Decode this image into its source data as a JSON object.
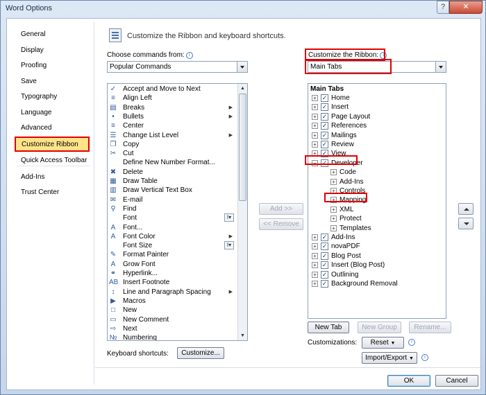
{
  "window": {
    "title": "Word Options",
    "help_glyph": "?",
    "close_glyph": "✕"
  },
  "nav": {
    "items": [
      {
        "label": "General"
      },
      {
        "label": "Display"
      },
      {
        "label": "Proofing"
      },
      {
        "label": "Save"
      },
      {
        "label": "Typography"
      },
      {
        "label": "Language"
      },
      {
        "label": "Advanced"
      },
      {
        "label": "Customize Ribbon"
      },
      {
        "label": "Quick Access Toolbar"
      },
      {
        "label": "Add-Ins"
      },
      {
        "label": "Trust Center"
      }
    ],
    "selected": "Customize Ribbon"
  },
  "header": {
    "title": "Customize the Ribbon and keyboard shortcuts."
  },
  "commands": {
    "label": "Choose commands from:",
    "info_glyph": "i",
    "selected": "Popular Commands",
    "items": [
      {
        "label": "Accept and Move to Next",
        "icon": "✓"
      },
      {
        "label": "Align Left",
        "icon": "≡"
      },
      {
        "label": "Breaks",
        "icon": "▤",
        "sub": "▶"
      },
      {
        "label": "Bullets",
        "icon": "•",
        "sub": "▶"
      },
      {
        "label": "Center",
        "icon": "≡"
      },
      {
        "label": "Change List Level",
        "icon": "☰",
        "sub": "▶"
      },
      {
        "label": "Copy",
        "icon": "❐"
      },
      {
        "label": "Cut",
        "icon": "✂"
      },
      {
        "label": "Define New Number Format...",
        "icon": ""
      },
      {
        "label": "Delete",
        "icon": "✖"
      },
      {
        "label": "Draw Table",
        "icon": "▦"
      },
      {
        "label": "Draw Vertical Text Box",
        "icon": "▥"
      },
      {
        "label": "E-mail",
        "icon": "✉"
      },
      {
        "label": "Find",
        "icon": "⚲"
      },
      {
        "label": "Font",
        "icon": "",
        "spin": "I▾"
      },
      {
        "label": "Font...",
        "icon": "A"
      },
      {
        "label": "Font Color",
        "icon": "A",
        "sub": "▶"
      },
      {
        "label": "Font Size",
        "icon": "",
        "spin": "I▾"
      },
      {
        "label": "Format Painter",
        "icon": "✎"
      },
      {
        "label": "Grow Font",
        "icon": "A"
      },
      {
        "label": "Hyperlink...",
        "icon": "⚭"
      },
      {
        "label": "Insert Footnote",
        "icon": "AB"
      },
      {
        "label": "Line and Paragraph Spacing",
        "icon": "↕",
        "sub": "▶"
      },
      {
        "label": "Macros",
        "icon": "▶"
      },
      {
        "label": "New",
        "icon": "□"
      },
      {
        "label": "New Comment",
        "icon": "▭"
      },
      {
        "label": "Next",
        "icon": "⇨"
      },
      {
        "label": "Numbering",
        "icon": "№"
      }
    ],
    "scroll_up": "▲",
    "scroll_down": "▼"
  },
  "middle": {
    "add_label": "Add >>",
    "remove_label": "<< Remove"
  },
  "ribbon": {
    "label": "Customize the Ribbon:",
    "info_glyph": "i",
    "selected": "Main Tabs",
    "root_label": "Main Tabs",
    "expand_glyph": "+",
    "collapse_glyph": "−",
    "check_glyph": "✓",
    "tabs_before": [
      "Home",
      "Insert",
      "Page Layout",
      "References",
      "Mailings",
      "Review",
      "View"
    ],
    "developer": {
      "label": "Developer",
      "groups": [
        "Code",
        "Add-Ins",
        "Controls",
        "Mapping",
        "XML",
        "Protect",
        "Templates"
      ]
    },
    "tabs_after": [
      "Add-Ins",
      "novaPDF",
      "Blog Post",
      "Insert (Blog Post)",
      "Outlining",
      "Background Removal"
    ]
  },
  "ribbon_buttons": {
    "new_tab": "New Tab",
    "new_group": "New Group",
    "rename": "Rename..."
  },
  "customizations": {
    "label": "Customizations:",
    "reset": "Reset",
    "import_export": "Import/Export",
    "dropdown_glyph": "▼",
    "info_glyph": "i"
  },
  "keyboard": {
    "label": "Keyboard shortcuts:",
    "customize": "Customize..."
  },
  "dialog": {
    "ok": "OK",
    "cancel": "Cancel"
  },
  "colors": {
    "highlight_red": "#e00000",
    "nav_selected_fill": "#ffe48a"
  }
}
